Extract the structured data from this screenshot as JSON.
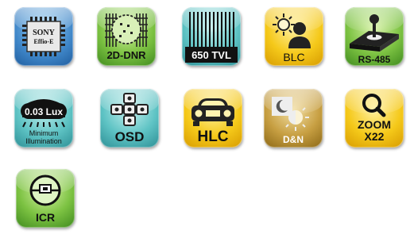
{
  "features": [
    {
      "label_line1": "SONY",
      "label_line2": "Effio-E",
      "icon": "chip-icon"
    },
    {
      "label": "2D-DNR",
      "icon": "noise-grid-icon"
    },
    {
      "label": "650 TVL",
      "icon": "vertical-lines-icon"
    },
    {
      "label": "BLC",
      "icon": "backlight-person-icon"
    },
    {
      "label": "RS-485",
      "icon": "joystick-icon"
    },
    {
      "label": "0.03 Lux",
      "caption_line1": "Minimum",
      "caption_line2": "Illumination",
      "icon": "low-light-icon"
    },
    {
      "label": "OSD",
      "icon": "menu-cross-icon"
    },
    {
      "label": "HLC",
      "icon": "car-headlight-icon"
    },
    {
      "label": "D&N",
      "icon": "day-night-icon"
    },
    {
      "label_line1": "ZOOM",
      "label_line2": "X22",
      "icon": "magnifier-icon"
    },
    {
      "label": "ICR",
      "icon": "ir-cut-filter-icon"
    }
  ],
  "colors": {
    "blue": "#3f86c8",
    "green": "#7cc242",
    "teal": "#5ec3c4",
    "yellow": "#f5c91a",
    "gold": "#c79f42"
  }
}
